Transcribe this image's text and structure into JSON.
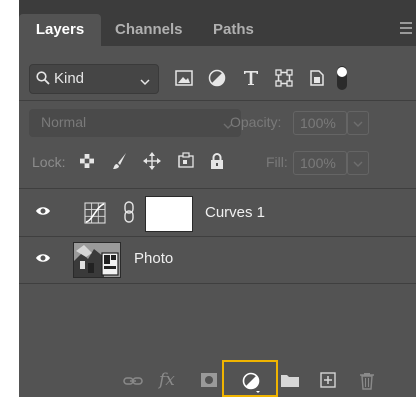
{
  "tabs": {
    "layers": "Layers",
    "channels": "Channels",
    "paths": "Paths"
  },
  "filter": {
    "kind_label": "Kind"
  },
  "blend": {
    "mode": "Normal",
    "opacity_label": "Opacity:",
    "opacity_value": "100%"
  },
  "lock": {
    "label": "Lock:",
    "fill_label": "Fill:",
    "fill_value": "100%"
  },
  "layers": [
    {
      "name": "Curves 1",
      "visible": true,
      "type": "adjustment"
    },
    {
      "name": "Photo",
      "visible": true,
      "type": "image"
    }
  ],
  "footer": {
    "fx_label": "fx"
  },
  "colors": {
    "panel_bg": "#535353",
    "tab_bar_bg": "#3c3c3c",
    "highlight": "#f0b400"
  }
}
